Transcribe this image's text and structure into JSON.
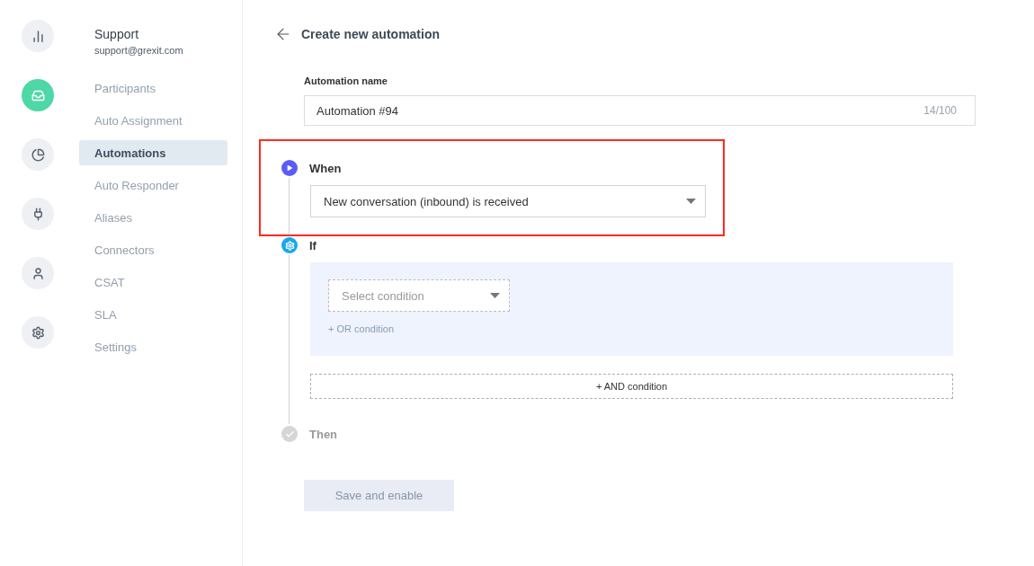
{
  "rail": [
    {
      "kind": "chart",
      "selected": false
    },
    {
      "kind": "inbox",
      "selected": true
    },
    {
      "kind": "pie",
      "selected": false
    },
    {
      "kind": "plug",
      "selected": false
    },
    {
      "kind": "user",
      "selected": false
    },
    {
      "kind": "gear",
      "selected": false
    }
  ],
  "sidebar": {
    "title": "Support",
    "subtitle": "support@grexit.com",
    "items": [
      {
        "label": "Participants",
        "selected": false
      },
      {
        "label": "Auto Assignment",
        "selected": false
      },
      {
        "label": "Automations",
        "selected": true
      },
      {
        "label": "Auto Responder",
        "selected": false
      },
      {
        "label": "Aliases",
        "selected": false
      },
      {
        "label": "Connectors",
        "selected": false
      },
      {
        "label": "CSAT",
        "selected": false
      },
      {
        "label": "SLA",
        "selected": false
      },
      {
        "label": "Settings",
        "selected": false
      }
    ]
  },
  "header": {
    "title": "Create new automation"
  },
  "name_field": {
    "label": "Automation name",
    "value": "Automation #94",
    "counter": "14/100"
  },
  "steps": [
    {
      "kind": "when",
      "label": "When",
      "disabled": false,
      "highlighted": true,
      "select": "New conversation (inbound) is received"
    },
    {
      "kind": "if",
      "label": "If",
      "disabled": false,
      "condition_placeholder": "Select condition",
      "or_link": "+ OR condition",
      "and_button": "+ AND condition"
    },
    {
      "kind": "then",
      "label": "Then",
      "disabled": true
    }
  ],
  "save_button": {
    "label": "Save and enable",
    "disabled": true
  }
}
